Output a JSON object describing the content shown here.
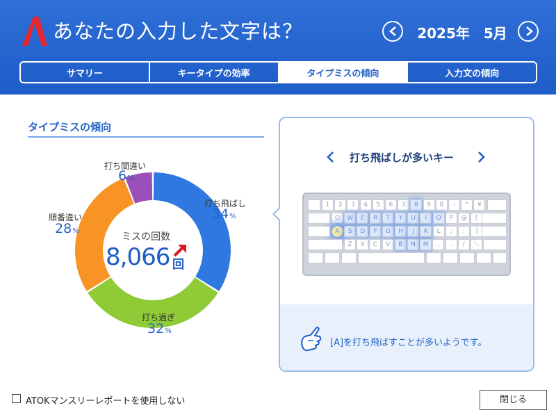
{
  "header": {
    "title": "あなたの入力した文字は？",
    "month_label": "2025年　5月",
    "colors": {
      "background": "#1e5cc8",
      "logo": "#e8262e"
    }
  },
  "tabs": [
    {
      "label": "サマリー",
      "active": false
    },
    {
      "label": "キータイプの効率",
      "active": false
    },
    {
      "label": "タイプミスの傾向",
      "active": true
    },
    {
      "label": "入力文の傾向",
      "active": false
    }
  ],
  "section": {
    "title": "タイプミスの傾向"
  },
  "chart_data": {
    "type": "pie",
    "center_caption": "ミスの回数",
    "total": "8,066",
    "total_unit": "回",
    "slices": [
      {
        "name": "打ち飛ばし",
        "value": 34,
        "pct_text": "34",
        "color": "#2f78e0"
      },
      {
        "name": "打ち過ぎ",
        "value": 32,
        "pct_text": "32",
        "color": "#8fcb37"
      },
      {
        "name": "順番違い",
        "value": 28,
        "pct_text": "28",
        "color": "#f79425"
      },
      {
        "name": "打ち間違い",
        "value": 6,
        "pct_text": "6",
        "color": "#9b4fb8"
      }
    ],
    "unit_symbol": "%"
  },
  "keyboard_panel": {
    "title": "打ち飛ばしが多いキー",
    "hint": "[A]を打ち飛ばすことが多いようです。",
    "rows": [
      {
        "keys": [
          "1",
          "2",
          "3",
          "4",
          "5",
          "6",
          "7",
          "8",
          "9",
          "0",
          "-",
          "^",
          "¥"
        ]
      },
      {
        "keys": [
          "Q",
          "W",
          "E",
          "R",
          "T",
          "Y",
          "U",
          "I",
          "O",
          "P",
          "@",
          "["
        ]
      },
      {
        "keys": [
          "A",
          "S",
          "D",
          "F",
          "G",
          "H",
          "J",
          "K",
          "L",
          ";",
          ":",
          "]"
        ]
      },
      {
        "keys": [
          "Z",
          "X",
          "C",
          "V",
          "B",
          "N",
          "M",
          ",",
          ".",
          "/",
          "＼"
        ]
      }
    ],
    "highlighted_keys": [
      "8",
      "U",
      "I",
      "Y",
      "O",
      "E",
      "R",
      "T",
      "W",
      "S",
      "D",
      "F",
      "G",
      "H",
      "J",
      "K",
      "B",
      "N",
      "M"
    ],
    "hot_key": "A"
  },
  "footer": {
    "checkbox_label": "ATOKマンスリーレポートを使用しない",
    "checkbox_checked": false,
    "close_label": "閉じる"
  }
}
